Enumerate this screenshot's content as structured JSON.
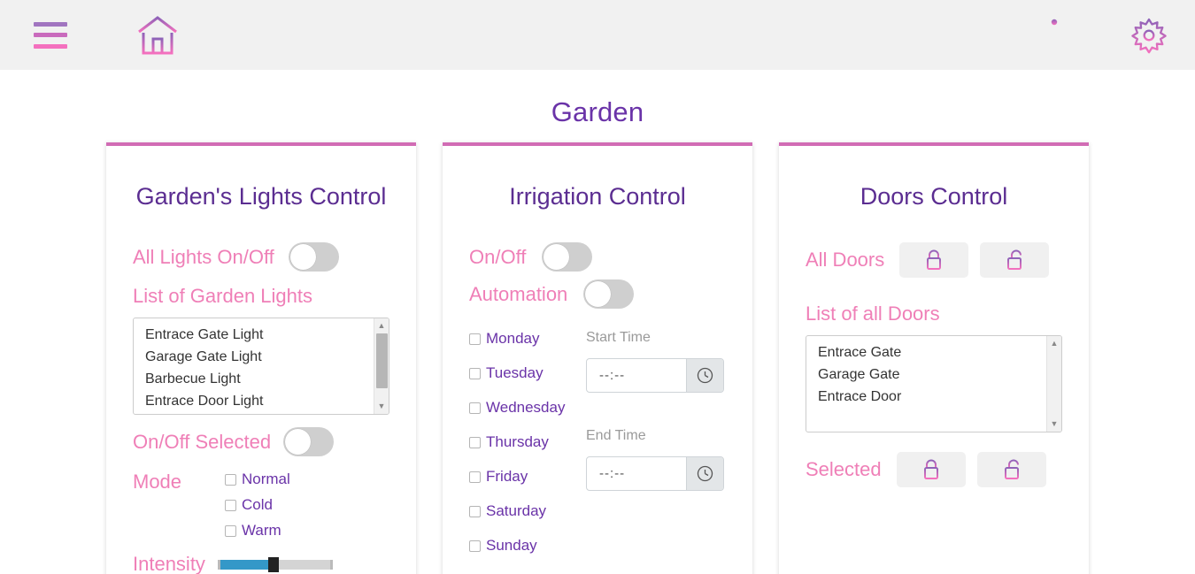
{
  "header": {
    "menu_icon": "hamburger-menu-icon",
    "home_icon": "home-icon",
    "info_icon": "info-icon",
    "settings_icon": "gear-icon"
  },
  "page": {
    "title": "Garden"
  },
  "theme": {
    "accent_pink": "#ef7fb7",
    "accent_purple": "#6a33a8",
    "card_border": "#d16cb4",
    "header_bg": "#f1f1f1",
    "slider_fill": "#3498c8"
  },
  "lights_card": {
    "title": "Garden's Lights Control",
    "all_toggle_label": "All Lights On/Off",
    "all_toggle_state": "off",
    "list_label": "List of Garden Lights",
    "list_items": [
      "Entrace Gate Light",
      "Garage Gate Light",
      "Barbecue Light",
      "Entrace Door Light"
    ],
    "selected_toggle_label": "On/Off Selected",
    "selected_toggle_state": "off",
    "mode_label": "Mode",
    "mode_options": [
      {
        "label": "Normal",
        "checked": false
      },
      {
        "label": "Cold",
        "checked": false
      },
      {
        "label": "Warm",
        "checked": false
      }
    ],
    "intensity_label": "Intensity",
    "intensity_value": 45
  },
  "irrigation_card": {
    "title": "Irrigation Control",
    "onoff_label": "On/Off",
    "onoff_state": "off",
    "automation_label": "Automation",
    "automation_state": "off",
    "days": [
      {
        "label": "Monday",
        "checked": false
      },
      {
        "label": "Tuesday",
        "checked": false
      },
      {
        "label": "Wednesday",
        "checked": false
      },
      {
        "label": "Thursday",
        "checked": false
      },
      {
        "label": "Friday",
        "checked": false
      },
      {
        "label": "Saturday",
        "checked": false
      },
      {
        "label": "Sunday",
        "checked": false
      }
    ],
    "start_time_label": "Start Time",
    "start_time_value": "--:--",
    "end_time_label": "End Time",
    "end_time_value": "--:--",
    "clock_icon": "clock-icon"
  },
  "doors_card": {
    "title": "Doors Control",
    "all_doors_label": "All Doors",
    "lock_icon": "lock-closed-icon",
    "unlock_icon": "lock-open-icon",
    "list_label": "List of all Doors",
    "list_items": [
      "Entrace Gate",
      "Garage Gate",
      "Entrace Door"
    ],
    "selected_label": "Selected"
  }
}
